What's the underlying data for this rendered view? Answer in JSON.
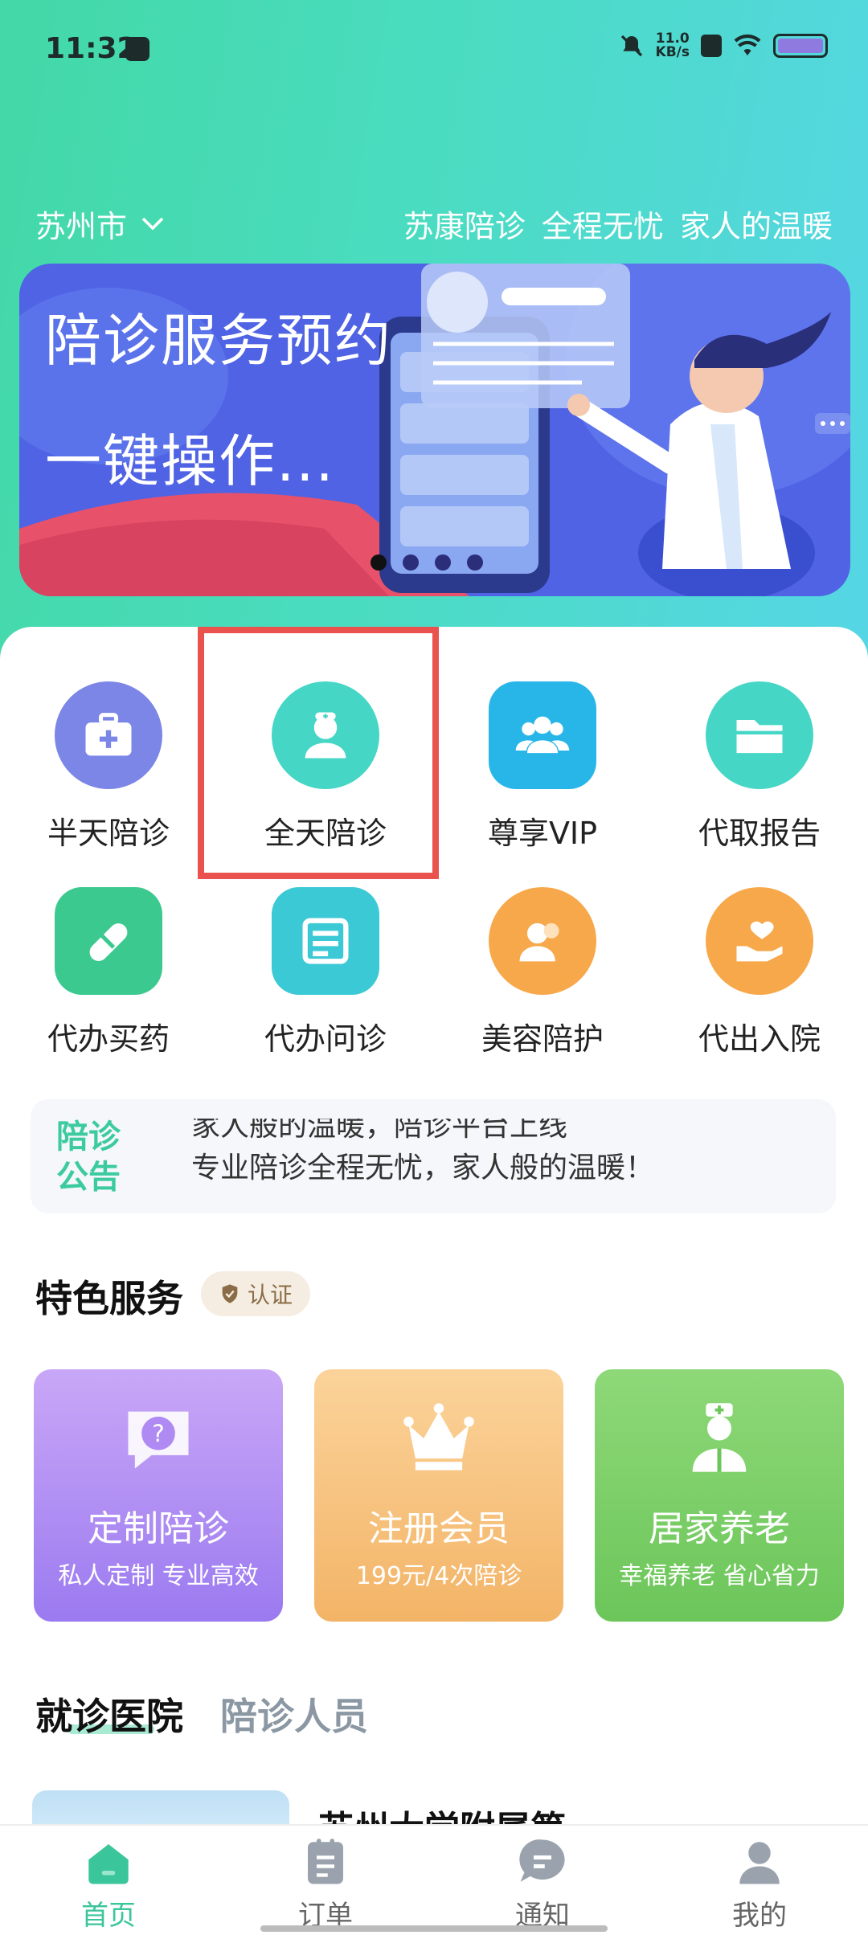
{
  "status_bar": {
    "time": "11:32",
    "net_speed_value": "11.0",
    "net_speed_unit": "KB/s"
  },
  "header": {
    "city": "苏州市",
    "slogan": "苏康陪诊 全程无忧 家人的温暖"
  },
  "banner": {
    "line1": "陪诊服务预约",
    "line2": "一键操作..."
  },
  "services": [
    {
      "label": "半天陪诊",
      "icon": "medical-kit-icon",
      "color": "#7b86e6"
    },
    {
      "label": "全天陪诊",
      "icon": "nurse-icon",
      "color": "#46d6c6"
    },
    {
      "label": "尊享VIP",
      "icon": "group-icon",
      "color": "#28b6e8"
    },
    {
      "label": "代取报告",
      "icon": "folder-icon",
      "color": "#46d6c6"
    },
    {
      "label": "代办买药",
      "icon": "pill-icon",
      "color": "#3cc98f"
    },
    {
      "label": "代办问诊",
      "icon": "document-icon",
      "color": "#3cc9d6"
    },
    {
      "label": "美容陪护",
      "icon": "people-icon",
      "color": "#f7a84a"
    },
    {
      "label": "代出入院",
      "icon": "heart-hand-icon",
      "color": "#f7a84a"
    }
  ],
  "notice": {
    "label": "陪诊公告",
    "line1": "家人般的温暖，陪诊平台上线",
    "line2": "专业陪诊全程无忧，家人般的温暖！"
  },
  "featured": {
    "title": "特色服务",
    "badge": "认证",
    "cards": [
      {
        "title": "定制陪诊",
        "subtitle": "私人定制 专业高效",
        "icon": "question-icon"
      },
      {
        "title": "注册会员",
        "subtitle": "199元/4次陪诊",
        "icon": "crown-icon"
      },
      {
        "title": "居家养老",
        "subtitle": "幸福养老 省心省力",
        "icon": "doctor-icon"
      }
    ]
  },
  "tabs": [
    "就诊医院",
    "陪诊人员"
  ],
  "hospital": {
    "name": "苏州大学附属第..."
  },
  "nav": [
    {
      "label": "首页",
      "icon": "home-icon",
      "active": true
    },
    {
      "label": "订单",
      "icon": "clipboard-icon",
      "active": false
    },
    {
      "label": "通知",
      "icon": "chat-icon",
      "active": false
    },
    {
      "label": "我的",
      "icon": "user-icon",
      "active": false
    }
  ]
}
